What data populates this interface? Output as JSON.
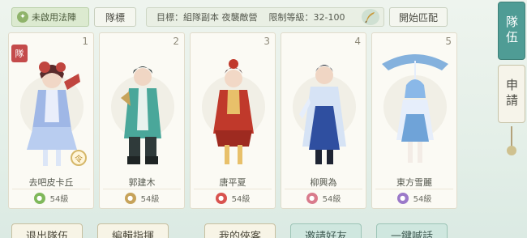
{
  "topbar": {
    "formation_label": "未啟用法陣",
    "mark_label": "隊標",
    "target_label": "目標：組隊副本 夜襲敵營",
    "level_limit_label": "限制等級：32-100",
    "start_match_label": "開始匹配"
  },
  "side": {
    "team_tab": "隊伍",
    "apply_tab": "申請"
  },
  "members": [
    {
      "slot": "1",
      "name": "去吧皮卡丘",
      "level": "54級",
      "badge_color": "#7fb85a",
      "outfit": "#9fb7e6",
      "accent": "#c0453f"
    },
    {
      "slot": "2",
      "name": "郭建木",
      "level": "54級",
      "badge_color": "#c7a35a",
      "outfit": "#4aa79a",
      "accent": "#2f3a3a"
    },
    {
      "slot": "3",
      "name": "唐平夏",
      "level": "54級",
      "badge_color": "#d9534f",
      "outfit": "#c0392b",
      "accent": "#e8c06a"
    },
    {
      "slot": "4",
      "name": "柳興為",
      "level": "54級",
      "badge_color": "#d97b8c",
      "outfit": "#2f4fa0",
      "accent": "#d6e3f5"
    },
    {
      "slot": "5",
      "name": "東方雪麗",
      "level": "54級",
      "badge_color": "#9b79c9",
      "outfit": "#6fa3d8",
      "accent": "#e6eefb"
    }
  ],
  "seal_char": "隊",
  "ling_char": "令",
  "bottom": {
    "leave_team": "退出隊伍",
    "edit_command": "編輯指揮",
    "my_guests": "我的俠客",
    "invite_friends": "邀請好友",
    "one_click_shout": "一鍵喊話"
  },
  "icons": {
    "formation": "formation-icon",
    "quill": "quill-icon"
  }
}
